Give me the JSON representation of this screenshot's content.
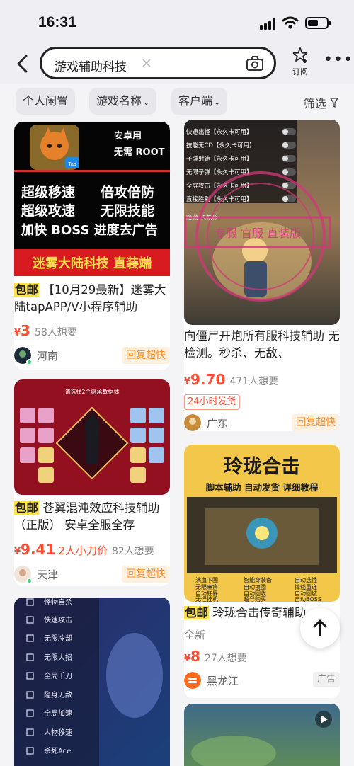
{
  "status_bar": {
    "time": "16:31"
  },
  "search": {
    "query": "游戏辅助科技",
    "subscribe_label": "订阅"
  },
  "filters": {
    "chips": [
      "个人闲置",
      "游戏名称",
      "客户端"
    ],
    "screen_label": "筛选"
  },
  "colors": {
    "price": "#ff4c32",
    "baoyou_bg": "#ffe14a",
    "reply_text": "#ff8a1f",
    "online_dot": "#2bd16c"
  },
  "listings": [
    {
      "banner": {
        "top_right_1": "安卓用",
        "top_right_2": "无需 ROOT",
        "line1_left": "超级移速",
        "line1_right": "倍攻倍防",
        "line2_left": "超级攻速",
        "line2_right": "无限技能",
        "line3": "加快 BOSS 进度去广告",
        "footer": "迷雾大陆科技 直装端",
        "app_icon_label": "Tap"
      },
      "baoyou": "包邮",
      "title": "【10月29最新】迷雾大陆tapAPP/V小程序辅助",
      "currency": "¥",
      "price": "3",
      "want": "58人想要",
      "location": "河南",
      "badge": "回复超快"
    },
    {
      "banner": {
        "menu": [
          "快速出怪【永久卡可用】",
          "技能无CD【永久卡可用】",
          "子弹射速【永久卡可用】",
          "无限子弹【永久卡可用】",
          "全屏攻击【永久卡可用】",
          "直接胜利【永久卡可用】"
        ],
        "hide_label": "隐藏/长按移",
        "stamp": "专服 官服 直装版"
      },
      "title": "向僵尸开炮所有服科技辅助 无检测。秒杀、无敌、",
      "currency": "¥",
      "price": "9.70",
      "want": "471人想要",
      "tag": "24小时发货",
      "location": "广东",
      "badge": "回复超快"
    },
    {
      "banner": {
        "top_text": "请选择2个继承数据体"
      },
      "baoyou": "包邮",
      "title": "苍翼混沌效应科技辅助（正版） 安卓全服全存",
      "currency": "¥",
      "price": "9.41",
      "discount": "2人小刀价",
      "want": "82人想要",
      "location": "天津",
      "badge": "回复超快"
    },
    {
      "banner": {
        "title": "玲珑合击",
        "subtitle": "脚本辅助  自动发货  详细教程",
        "checklist_left": [
          "满血下围",
          "无限麻痹",
          "自动狂暴",
          "无怪挂机"
        ],
        "checklist_mid": [
          "智能穿装备",
          "自动换图",
          "自动回收",
          "超号购买"
        ],
        "checklist_right": [
          "自动选怪",
          "掉线重连",
          "自动回城",
          "自动BOSS"
        ]
      },
      "baoyou": "包邮",
      "title": "玲珑合击传奇辅助 ",
      "condition": "全新",
      "currency": "¥",
      "price": "8",
      "want": "27人想要",
      "location": "黑龙江",
      "badge": "广告"
    },
    {
      "banner": {
        "menu": [
          "怪物自杀",
          "快速攻击",
          "无限冷却",
          "无限大招",
          "全局千刀",
          "隐身无敌",
          "全局加速",
          "人物移速",
          "杀死Ace"
        ]
      }
    }
  ]
}
